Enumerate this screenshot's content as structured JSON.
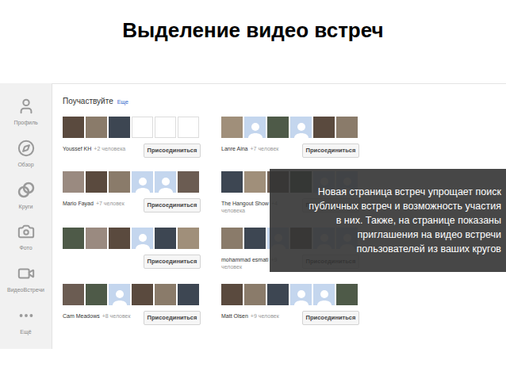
{
  "slide": {
    "title": "Выделение видео встреч"
  },
  "sidebar": {
    "items": [
      {
        "label": "Профиль",
        "icon": "profile"
      },
      {
        "label": "Обзор",
        "icon": "explore"
      },
      {
        "label": "Круги",
        "icon": "circles"
      },
      {
        "label": "Фото",
        "icon": "photos"
      },
      {
        "label": "ВидеоВстречи",
        "icon": "hangouts"
      },
      {
        "label": "Ещё",
        "icon": "more"
      }
    ]
  },
  "section": {
    "title": "Поучаствуйте",
    "link": "Еще"
  },
  "hangouts": [
    {
      "name": "Youssef KH",
      "count": "+2 человека",
      "button": "Присоединиться",
      "thumbs": [
        "photo",
        "photo",
        "photo",
        "empty",
        "empty",
        "empty"
      ]
    },
    {
      "name": "Lanre Aina",
      "count": "+7 человек",
      "button": "Присоединиться",
      "thumbs": [
        "photo",
        "avatar",
        "photo",
        "avatar",
        "photo",
        "photo"
      ]
    },
    {
      "name": "Mario Fayad",
      "count": "+7 человек",
      "button": "Присоединиться",
      "thumbs": [
        "photo",
        "photo",
        "photo",
        "avatar",
        "avatar",
        "photo"
      ]
    },
    {
      "name": "The Hangout Show",
      "count": "+4 человека",
      "button": "Присоединиться",
      "thumbs": [
        "photo",
        "photo",
        "photo",
        "photo",
        "avatar",
        "avatar"
      ]
    },
    {
      "button": "Присоединиться",
      "thumbs": [
        "photo",
        "photo",
        "photo",
        "avatar",
        "photo",
        "photo"
      ]
    },
    {
      "name": "mohammad esmati",
      "count": "+9 человек",
      "button": "Присоединиться",
      "thumbs": [
        "photo",
        "photo",
        "avatar",
        "photo",
        "avatar",
        "avatar"
      ]
    },
    {
      "name": "Cam Meadows",
      "count": "+8 человек",
      "button": "Присоединиться",
      "thumbs": [
        "photo",
        "photo",
        "avatar",
        "photo",
        "photo",
        "photo"
      ]
    },
    {
      "name": "Matt Olsen",
      "count": "+9 человек",
      "button": "Присоединиться",
      "thumbs": [
        "photo",
        "photo",
        "photo",
        "avatar",
        "avatar",
        "photo"
      ]
    }
  ],
  "overlay": {
    "lines": [
      "Новая страница встреч упрощает поиск",
      "публичных встреч и возможность участия",
      "в них. Также, на странице показаны",
      "приглашения на видео встречи",
      "пользователей из ваших кругов"
    ]
  }
}
